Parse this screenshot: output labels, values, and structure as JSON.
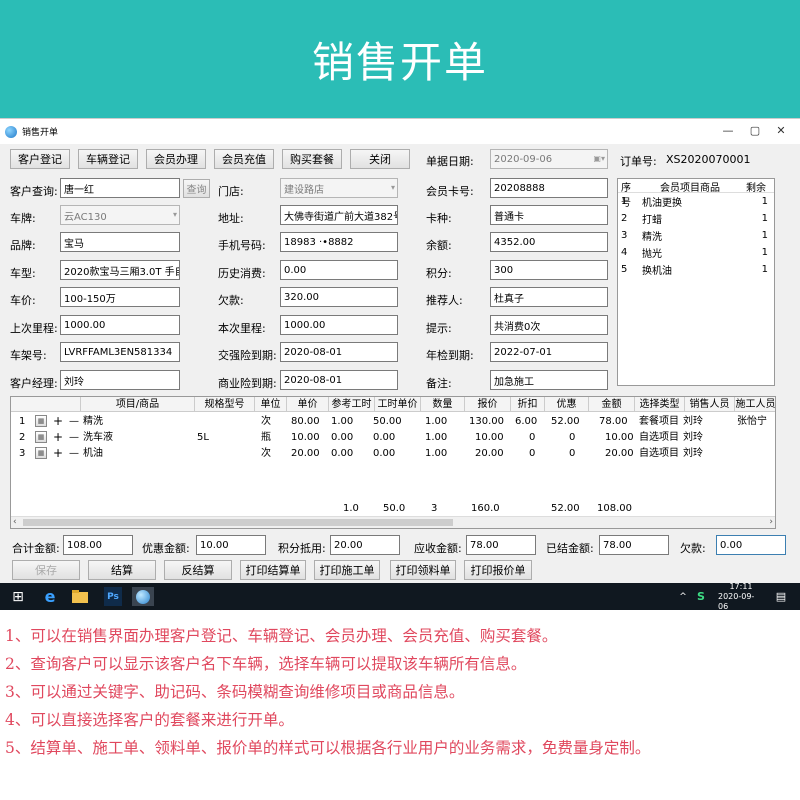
{
  "banner": {
    "title": "销售开单"
  },
  "window": {
    "title": "销售开单",
    "minimize": "—",
    "maximize": "▢",
    "close": "✕"
  },
  "toolbar": [
    "客户登记",
    "车辆登记",
    "会员办理",
    "会员充值",
    "购买套餐",
    "关闭"
  ],
  "header": {
    "date_label": "单据日期:",
    "date_value": "2020-09-06",
    "order_label": "订单号:",
    "order_value": "XS2020070001"
  },
  "form": {
    "customer_query_label": "客户查询:",
    "customer_query_value": "唐一红",
    "query_button": "查询",
    "store_label": "门店:",
    "store_value": "建设路店",
    "member_card_label": "会员卡号:",
    "member_card_value": "20208888",
    "plate_label": "车牌:",
    "plate_value": "云AC130",
    "address_label": "地址:",
    "address_value": "大佛寺街道广前大道382号",
    "card_type_label": "卡种:",
    "card_type_value": "普通卡",
    "brand_label": "品牌:",
    "brand_value": "宝马",
    "phone_label": "手机号码:",
    "phone_value": "18983 ·•8882",
    "balance_label": "余额:",
    "balance_value": "4352.00",
    "model_label": "车型:",
    "model_value": "2020款宝马三厢3.0T 手自",
    "history_label": "历史消费:",
    "history_value": "0.00",
    "points_label": "积分:",
    "points_value": "300",
    "price_label": "车价:",
    "price_value": "100-150万",
    "debt_label": "欠款:",
    "debt_value": "320.00",
    "referrer_label": "推荐人:",
    "referrer_value": "杜真子",
    "last_mileage_label": "上次里程:",
    "last_mileage_value": "1000.00",
    "this_mileage_label": "本次里程:",
    "this_mileage_value": "1000.00",
    "hint_label": "提示:",
    "hint_value": "共消费0次",
    "vin_label": "车架号:",
    "vin_value": "LVRFFAML3EN581334",
    "compulsory_label": "交强险到期:",
    "compulsory_value": "2020-08-01",
    "inspection_label": "年检到期:",
    "inspection_value": "2022-07-01",
    "manager_label": "客户经理:",
    "manager_value": "刘玲",
    "commercial_label": "商业险到期:",
    "commercial_value": "2020-08-01",
    "remark_label": "备注:",
    "remark_value": "加急施工"
  },
  "packages": {
    "headers": [
      "序号",
      "会员项目商品",
      "剩余"
    ],
    "rows": [
      [
        "1",
        "机油更换",
        "1"
      ],
      [
        "2",
        "打蜡",
        "1"
      ],
      [
        "3",
        "精洗",
        "1"
      ],
      [
        "4",
        "抛光",
        "1"
      ],
      [
        "5",
        "换机油",
        "1"
      ]
    ]
  },
  "grid": {
    "headers": [
      "项目/商品",
      "规格型号",
      "单位",
      "单价",
      "参考工时",
      "工时单价",
      "数量",
      "报价",
      "折扣",
      "优惠",
      "金额",
      "选择类型",
      "销售人员",
      "施工人员"
    ],
    "row_icon": "▦",
    "plus": "+",
    "minus": "—",
    "rows": [
      [
        "1",
        "精洗",
        "",
        "次",
        "80.00",
        "1.00",
        "50.00",
        "1.00",
        "130.00",
        "6.00",
        "52.00",
        "78.00",
        "套餐项目",
        "刘玲",
        "张怡宁"
      ],
      [
        "2",
        "洗车液",
        "5L",
        "瓶",
        "10.00",
        "0.00",
        "0.00",
        "1.00",
        "10.00",
        "0",
        "0",
        "10.00",
        "自选项目",
        "刘玲",
        ""
      ],
      [
        "3",
        "机油",
        "",
        "次",
        "20.00",
        "0.00",
        "0.00",
        "1.00",
        "20.00",
        "0",
        "0",
        "20.00",
        "自选项目",
        "刘玲",
        ""
      ]
    ],
    "totals": {
      "hours": "1.0",
      "hour_price": "50.0",
      "qty": "3",
      "quote": "160.0",
      "discount": "52.00",
      "amount": "108.00"
    },
    "scroll_left": "‹",
    "scroll_right": "›"
  },
  "summary": {
    "total_label": "合计金额:",
    "total_value": "108.00",
    "discount_label": "优惠金额:",
    "discount_value": "10.00",
    "points_label": "积分抵用:",
    "points_value": "20.00",
    "receivable_label": "应收金额:",
    "receivable_value": "78.00",
    "paid_label": "已结金额:",
    "paid_value": "78.00",
    "owed_label": "欠款:",
    "owed_value": "0.00"
  },
  "actions": [
    "保存",
    "结算",
    "反结算",
    "打印结算单",
    "打印施工单",
    "打印领料单",
    "打印报价单"
  ],
  "taskbar": {
    "time": "17:11",
    "date": "2020-09-06",
    "ps": "Ps",
    "tray_arrow": "^",
    "tray_s": "S",
    "notify": "▤",
    "start": "⊞",
    "edge": "e"
  },
  "notes": [
    "1、可以在销售界面办理客户登记、车辆登记、会员办理、会员充值、购买套餐。",
    "2、查询客户可以显示该客户名下车辆，选择车辆可以提取该车辆所有信息。",
    "3、可以通过关键字、助记码、条码模糊查询维修项目或商品信息。",
    "4、可以直接选择客户的套餐来进行开单。",
    "5、结算单、施工单、领料单、报价单的样式可以根据各行业用户的业务需求，免费量身定制。"
  ],
  "colors": {
    "banner": "#2bbdb6",
    "note_text": "#e0485e",
    "taskbar": "#101820"
  }
}
